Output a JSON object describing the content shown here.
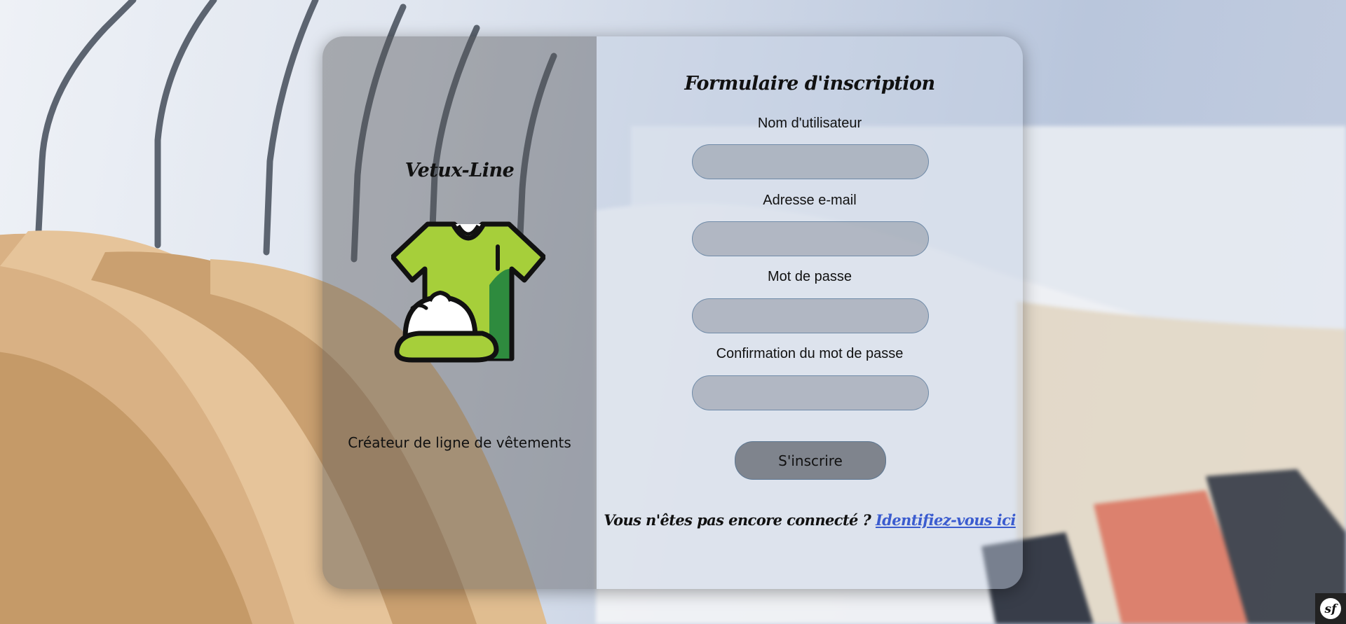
{
  "brand": {
    "name": "Vetux-Line",
    "tagline": "Créateur de ligne de vêtements",
    "logo_icon": "tshirt-cap-icon"
  },
  "form": {
    "title": "Formulaire d'inscription",
    "fields": [
      {
        "label": "Nom d'utilisateur",
        "value": "",
        "placeholder": ""
      },
      {
        "label": "Adresse e-mail",
        "value": "",
        "placeholder": ""
      },
      {
        "label": "Mot de passe",
        "value": "",
        "placeholder": ""
      },
      {
        "label": "Confirmation du mot de passe",
        "value": "",
        "placeholder": ""
      }
    ],
    "submit_label": "S'inscrire",
    "login_prompt": "Vous n'êtes pas encore connecté ? ",
    "login_link": "Identifiez-vous ici"
  },
  "toolbar": {
    "icon": "symfony-icon"
  },
  "colors": {
    "shirt": "#a6cf3a",
    "shirt_shadow": "#2e8b3e",
    "link": "#3b5ccf"
  }
}
